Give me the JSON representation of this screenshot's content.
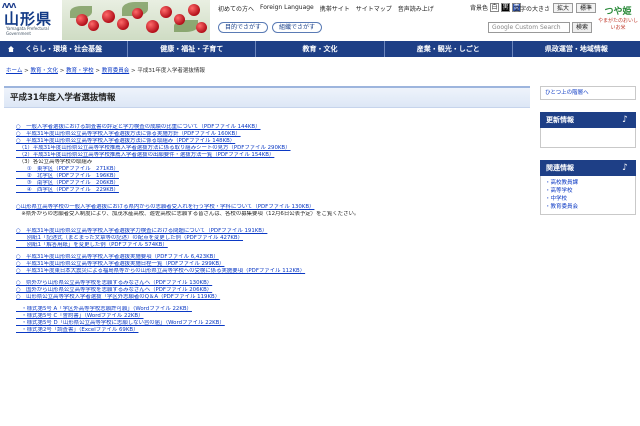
{
  "header": {
    "logo_mark": "ΛΛΛ",
    "logo_name": "山形県",
    "logo_sub": "Yamagata Prefectural Government",
    "top_links": [
      "初めての方へ",
      "Foreign Language",
      "携帯サイト",
      "サイトマップ",
      "音声読み上げ"
    ],
    "bg_label": "背景色",
    "bg_options": [
      "白",
      "黒",
      "青"
    ],
    "font_label": "文字の大きさ",
    "font_larger": "拡大",
    "font_std": "標準",
    "pill_buttons": [
      "目的でさがす",
      "組織でさがす"
    ],
    "search_placeholder": "Google Custom Search",
    "search_button": "検索",
    "mascot_name": "つや姫",
    "mascot_sub": "やまがたのおいしいお米"
  },
  "nav": {
    "items": [
      "くらし・環境・社会基盤",
      "健康・福祉・子育て",
      "教育・文化",
      "産業・観光・しごと",
      "県政運営・地域情報"
    ]
  },
  "breadcrumb": {
    "items": [
      "ホーム",
      "教育・文化",
      "教育・学校",
      "教育委員会"
    ],
    "current": "平成31年度入学者選抜情報",
    "sep": " > "
  },
  "page": {
    "title": "平成31年度入学者選抜情報"
  },
  "content": {
    "g1": [
      "○　一般入学者選抜における調査書の評定と学力検査の成績の比重について（PDFファイル 144KB）",
      "○　平成31年度山形県公立高等学校入学者選抜方法に係る実施方針（PDFファイル 160KB）",
      "○　平成31年度山形県公立高等学校入学者選抜方法に係る取組み（PDFファイル 148KB）",
      "　（1）平成31年度山形県公立高等学校推薦入学者選抜方法に係る取り組みシートの見方（PDFファイル 290KB）",
      "　（2）平成31年度山形県公立高等学校推薦入学者選抜の出願要件・選抜方法一覧（PDFファイル 154KB）",
      "　（3）各公立高等学校の取組み",
      "　　①　東学区（PDFファイル　271KB）",
      "　　②　北学区（PDFファイル　196KB）",
      "　　③　南学区（PDFファイル　206KB）",
      "　　④　西学区（PDFファイル　229KB）"
    ],
    "g2": [
      "○山形県立高等学校の一般入学者選抜における県内からの志願者受入れを行う学校・学科について（PDFファイル 130KB）",
      "　※県外からの志願者受入制度により、加茂水産高校、遊佐高校に志願する皆さんは、各校の募集要項（12月6日公表予定）をご覧ください。"
    ],
    "g3": [
      "○　平成31年度山形県公立高等学校入学者選抜学力検査における問題について（PDFファイル 191KB）",
      "　　別紙1「記述式（まとまった文章等の記述）の配点を変更した例（PDFファイル 427KB）",
      "　　別紙1「解答用紙」を変更した例（PDFファイル 574KB）"
    ],
    "g4": [
      "○　平成31年度山形県公立高等学校入学者選抜実施要項（PDFファイル 6,423KB）",
      "○　平成31年度山形県公立高等学校入学者選抜実施日程一覧（PDFファイル 299KB）",
      "○　平成31年度東日本大震災による福島県等からの山形県立高等学校への受検に係る実施要項（PDFファイル 112KB）"
    ],
    "g5": [
      "○　県外から山形県公立高等学校を志願するみなさんへ（PDFファイル 130KB）",
      "○　国外から山形県公立高等学校を志願するみなさんへ（PDFファイル 206KB）",
      "○　山形県公立高等学校入学者選抜「学区外志願者のQ＆A（PDFファイル 119KB）"
    ],
    "g6": [
      "　・様式第5号 A「学区外高等学校志願許可願」（Wordファイル 22KB）",
      "　・様式第5号 C「誓約書」（Wordファイル 22KB）",
      "　・様式第5号 D「山形県公立高等学校に志願しない旨の届」（Wordファイル 22KB）",
      "　・様式第2号「調査書」（Excelファイル 69KB）"
    ]
  },
  "sidebar": {
    "up_link": "ひとつ上の階層へ",
    "updates_title": "更新情報",
    "related_title": "関連情報",
    "related_links": [
      "・高校教員課",
      "・高等学校",
      "・中学校",
      "・教育委員会"
    ]
  },
  "colors": {
    "nav_bg": "#1e3f86",
    "link": "#0b39c4"
  }
}
